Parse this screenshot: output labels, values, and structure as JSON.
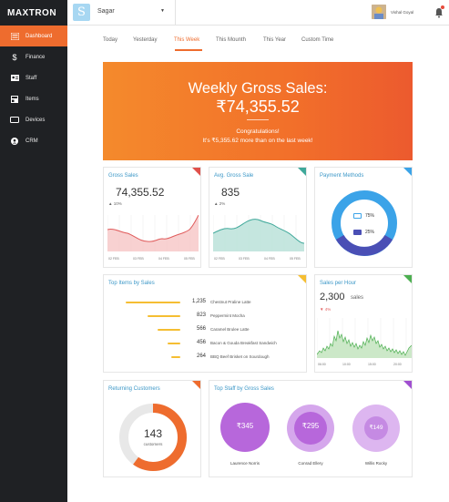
{
  "sidebar": {
    "logo": "MAXTRON",
    "items": [
      {
        "label": "Dashboard",
        "icon": "dashboard-icon"
      },
      {
        "label": "Finance",
        "icon": "dollar-icon"
      },
      {
        "label": "Staff",
        "icon": "staff-card-icon"
      },
      {
        "label": "Items",
        "icon": "items-icon"
      },
      {
        "label": "Devices",
        "icon": "device-icon"
      },
      {
        "label": "CRM",
        "icon": "crm-icon"
      }
    ]
  },
  "header": {
    "brand_letter": "S",
    "store_name": "Sagar",
    "user_name": "Vishal Goyal"
  },
  "tabs": [
    "Today",
    "Yesterday",
    "This Week",
    "This Mounth",
    "This Year",
    "Custom Time"
  ],
  "active_tab": "This Week",
  "hero": {
    "title": "Weekly Gross Sales:",
    "value": "₹74,355.52",
    "congrats": "Congratulations!",
    "message": "It's ₹5,355.62 more than on the last week!"
  },
  "gross_sales": {
    "title": "Gross Sales",
    "value": "74,355.52",
    "delta": "▲ 10%",
    "x_labels": [
      "02 FEB",
      "03 FEB",
      "04 FEB",
      "05 FEB"
    ]
  },
  "avg_sale": {
    "title": "Avg. Gross Sale",
    "value": "835",
    "delta": "▲ 2%",
    "x_labels": [
      "02 FEB",
      "03 FEB",
      "04 FEB",
      "05 FEB"
    ]
  },
  "payment_methods": {
    "title": "Payment Methods",
    "card_pct": "75%",
    "cash_pct": "25%"
  },
  "top_items": {
    "title": "Top Items by Sales",
    "items": [
      {
        "value": "1,235",
        "label": "Chestnut Praline Latte",
        "fraction": 1.0
      },
      {
        "value": "823",
        "label": "Peppermint Mocha",
        "fraction": 0.6
      },
      {
        "value": "566",
        "label": "Caramel Brulee Latte",
        "fraction": 0.42
      },
      {
        "value": "456",
        "label": "Bacon & Gouda Breakfast Sandwich",
        "fraction": 0.24
      },
      {
        "value": "264",
        "label": "BBQ Beef Brisket on Sourdough",
        "fraction": 0.16
      }
    ]
  },
  "sales_per_hour": {
    "title": "Sales per Hour",
    "value": "2,300",
    "unit": "sales",
    "delta": "▼ 4%",
    "x_labels": [
      "06:00",
      "10:00",
      "15:00",
      "20:00"
    ]
  },
  "returning": {
    "title": "Returning Customers",
    "value": "143",
    "label": "customers",
    "fraction": 0.6
  },
  "top_staff": {
    "title": "Top Staff by Gross Sales",
    "staff": [
      {
        "value": "₹345",
        "name": "Laurence Norris"
      },
      {
        "value": "₹295",
        "name": "Conrad Ellery"
      },
      {
        "value": "₹149",
        "name": "Willis Rocky"
      }
    ]
  },
  "colors": {
    "accent": "#ee6c2e",
    "blue": "#3b97c7",
    "red_series": "#e06666",
    "teal_series": "#3fa89a",
    "green_series": "#4caf50",
    "purple": "#a04fd0"
  }
}
